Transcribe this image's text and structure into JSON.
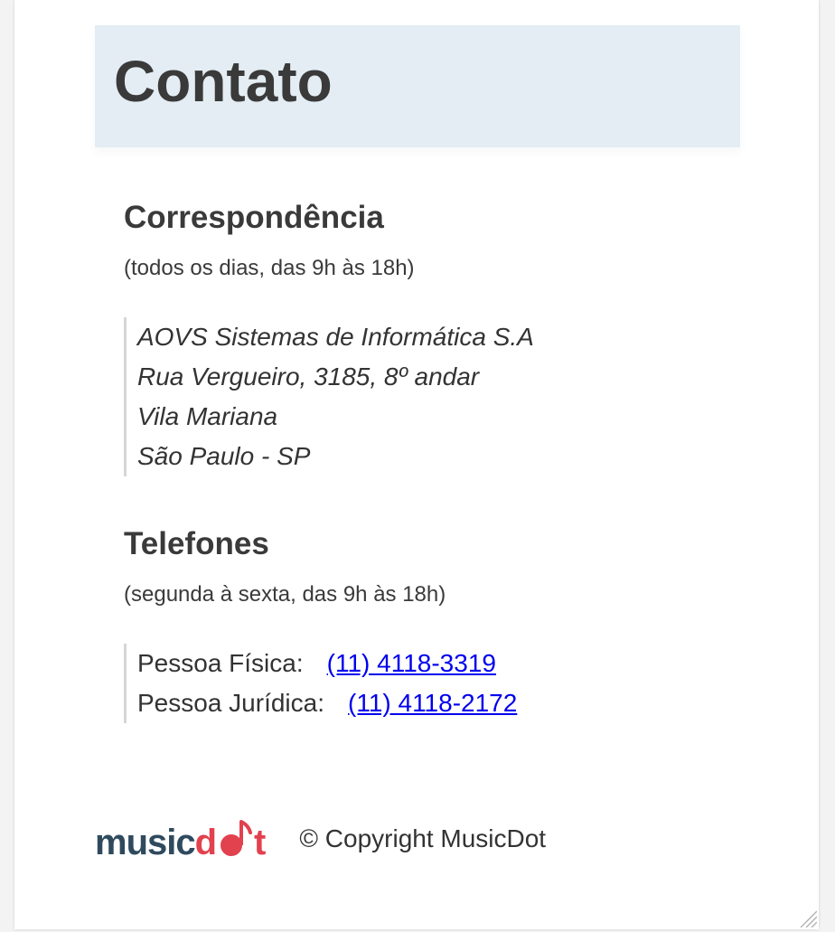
{
  "page": {
    "title": "Contato"
  },
  "correspondence": {
    "title": "Correspondência",
    "hours": "(todos os dias, das 9h às 18h)",
    "address_lines": [
      "AOVS Sistemas de Informática S.A",
      "Rua Vergueiro, 3185, 8º andar",
      "Vila Mariana",
      "São Paulo - SP"
    ]
  },
  "phones": {
    "title": "Telefones",
    "hours": "(segunda à sexta, das 9h às 18h)",
    "items": [
      {
        "label": "Pessoa Física:",
        "number": "(11) 4118-3319"
      },
      {
        "label": "Pessoa Jurídica:",
        "number": "(11) 4118-2172"
      }
    ]
  },
  "footer": {
    "logo_text_part1": "music",
    "logo_text_part2": "d",
    "logo_text_part3": "t",
    "copyright": "© Copyright MusicDot"
  },
  "colors": {
    "header_bg": "#e3edf3",
    "logo_dark": "#2f4a5e",
    "logo_accent": "#e2414e",
    "link": "#0000ee"
  },
  "icons": {
    "logo_note": "music-note-icon",
    "resize": "resize-grip-icon"
  }
}
